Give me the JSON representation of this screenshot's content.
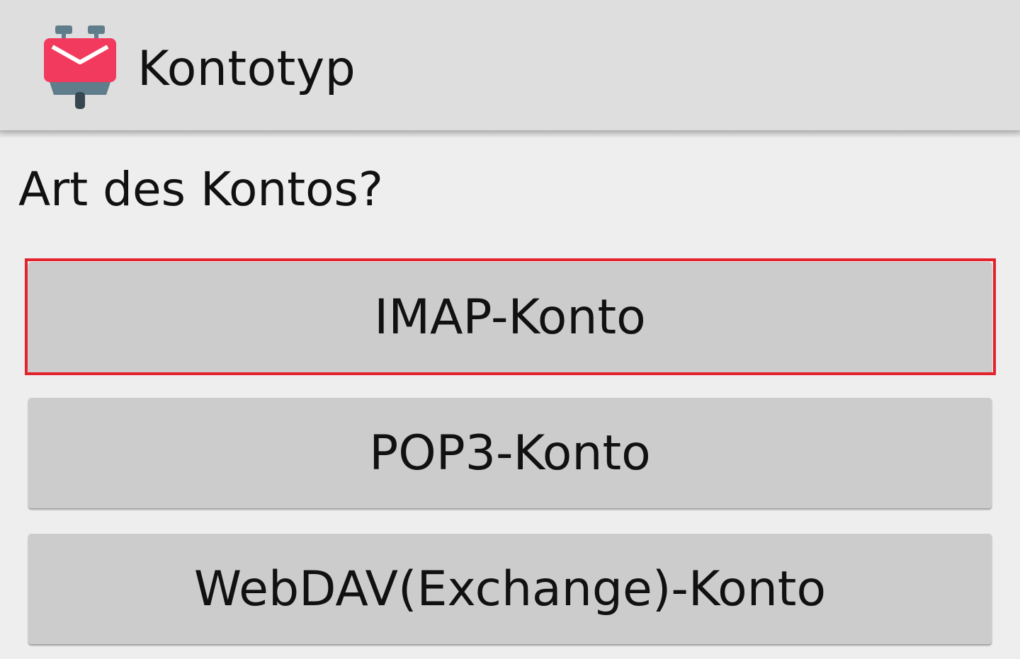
{
  "app_bar": {
    "title": "Kontotyp",
    "icon": "k9-mail-robot-icon",
    "icon_color": "#f23a5e"
  },
  "prompt": "Art des Kontos?",
  "account_types": [
    {
      "label": "IMAP-Konto",
      "selected": true
    },
    {
      "label": "POP3-Konto",
      "selected": false
    },
    {
      "label": "WebDAV(Exchange)-Konto",
      "selected": false
    }
  ],
  "colors": {
    "app_bar_bg": "#dedede",
    "page_bg": "#eeeeee",
    "button_bg": "#cccccc",
    "highlight": "#e3232c"
  }
}
